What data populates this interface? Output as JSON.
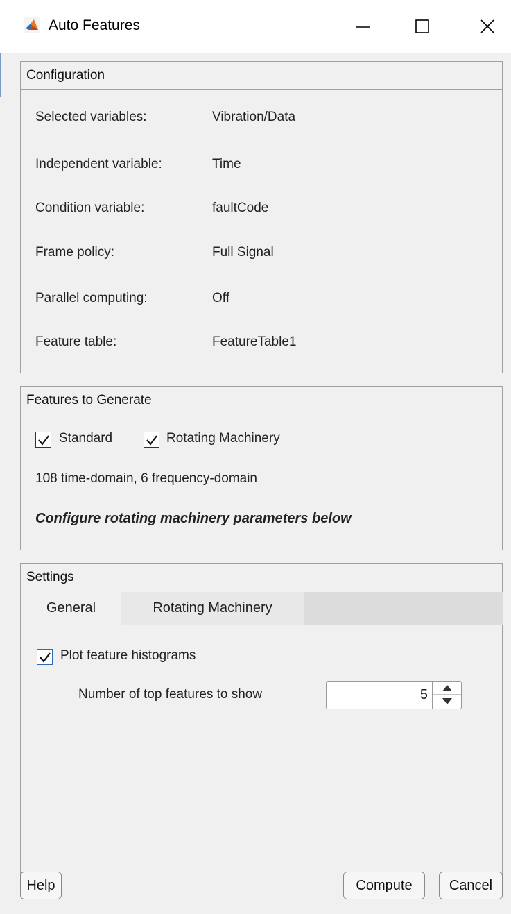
{
  "window": {
    "title": "Auto Features",
    "icons": {
      "app": "matlab-icon",
      "minimize": "minimize-icon",
      "maximize": "maximize-icon",
      "close": "close-icon"
    }
  },
  "configuration": {
    "header": "Configuration",
    "rows": [
      {
        "label": "Selected variables:",
        "value": "Vibration/Data"
      },
      {
        "label": "Independent variable:",
        "value": "Time"
      },
      {
        "label": "Condition variable:",
        "value": "faultCode"
      },
      {
        "label": "Frame policy:",
        "value": "Full Signal"
      },
      {
        "label": "Parallel computing:",
        "value": "Off"
      },
      {
        "label": "Feature table:",
        "value": "FeatureTable1"
      }
    ]
  },
  "features": {
    "header": "Features to Generate",
    "standard_label": "Standard",
    "standard_checked": true,
    "rotating_label": "Rotating Machinery",
    "rotating_checked": true,
    "summary": "108 time-domain, 6 frequency-domain",
    "hint": "Configure rotating machinery parameters below"
  },
  "settings": {
    "header": "Settings",
    "tabs": [
      "General",
      "Rotating Machinery"
    ],
    "active_tab": "General",
    "plot_hist_label": "Plot feature histograms",
    "plot_hist_checked": true,
    "top_features_label": "Number of top features to show",
    "top_features_value": "5"
  },
  "buttons": {
    "help": "Help",
    "compute": "Compute",
    "cancel": "Cancel"
  },
  "colors": {
    "accent": "#2b6cb0",
    "panel_bg": "#f0f0f0",
    "border": "#a0a0a0"
  }
}
